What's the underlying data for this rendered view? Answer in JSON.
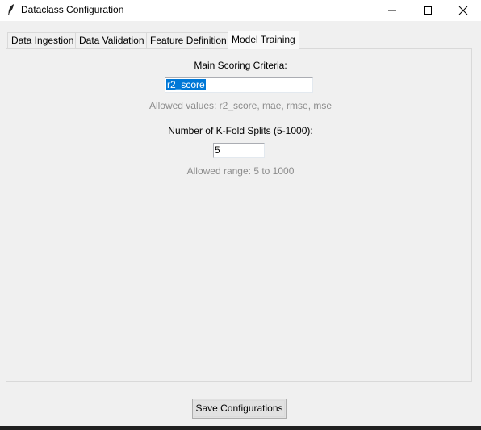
{
  "window": {
    "title": "Dataclass Configuration",
    "app_icon": "feather-icon",
    "controls": [
      "minimize-icon",
      "maximize-icon",
      "close-icon"
    ]
  },
  "tabs": [
    {
      "label": "Data Ingestion",
      "active": false
    },
    {
      "label": "Data Validation",
      "active": false
    },
    {
      "label": "Feature Definition",
      "active": false
    },
    {
      "label": "Model Training",
      "active": true
    }
  ],
  "model_training": {
    "scoring": {
      "label": "Main Scoring Criteria:",
      "value": "r2_score",
      "hint": "Allowed values: r2_score, mae, rmse, mse"
    },
    "kfold": {
      "label": "Number of K-Fold Splits (5-1000):",
      "value": "5",
      "hint": "Allowed range: 5 to 1000"
    }
  },
  "actions": {
    "save_label": "Save Configurations"
  },
  "colors": {
    "selection": "#0078d7",
    "hint_text": "#8c8c8c",
    "background": "#f0f0f0"
  }
}
